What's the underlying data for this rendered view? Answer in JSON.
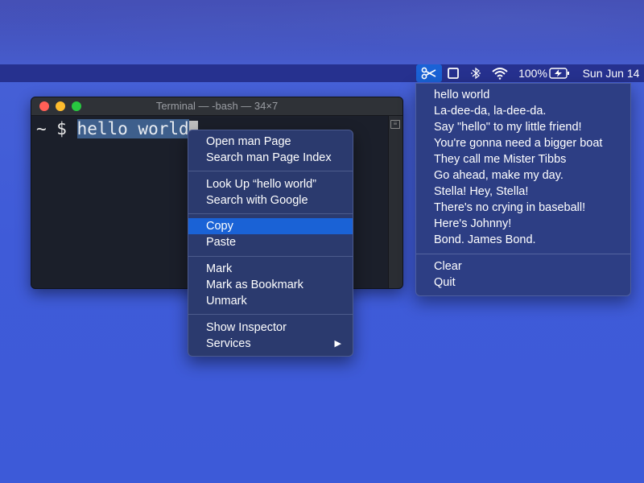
{
  "menubar": {
    "clipboard_icon": "scissors-icon",
    "window_icon": "window-square-icon",
    "bluetooth_icon": "bluetooth-icon",
    "wifi_icon": "wifi-icon",
    "battery_percent": "100%",
    "battery_icon": "battery-charging-icon",
    "clock": "Sun Jun 14"
  },
  "terminal": {
    "title": "Terminal — -bash — 34×7",
    "prompt": "~ $ ",
    "selected_text": "hello world"
  },
  "context_menu": {
    "groups": [
      [
        "Open man Page",
        "Search man Page Index"
      ],
      [
        "Look Up “hello world”",
        "Search with Google"
      ],
      [
        "Copy",
        "Paste"
      ],
      [
        "Mark",
        "Mark as Bookmark",
        "Unmark"
      ],
      [
        "Show Inspector",
        "Services"
      ]
    ],
    "highlighted": "Copy",
    "submenu_arrow": "▶"
  },
  "clipboard_menu": {
    "history": [
      "hello world",
      "La-dee-da, la-dee-da.",
      "Say \"hello\" to my little friend!",
      "You're gonna need a bigger boat",
      "They call me Mister Tibbs",
      "Go ahead, make my day.",
      "Stella! Hey, Stella!",
      "There's no crying in baseball!",
      "Here's Johnny!",
      "Bond. James Bond."
    ],
    "clear": "Clear",
    "quit": "Quit"
  },
  "colors": {
    "desktop": "#3e5bd6",
    "menubar": "#26318f",
    "highlight": "#1a62d6"
  }
}
